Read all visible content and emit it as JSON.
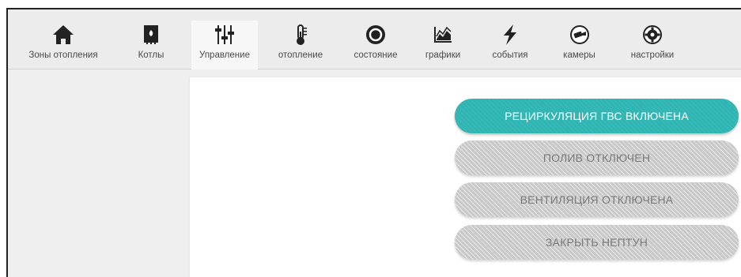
{
  "nav": {
    "tabs": [
      {
        "label": "Зоны отопления",
        "icon": "home-icon"
      },
      {
        "label": "Котлы",
        "icon": "boiler-icon"
      },
      {
        "label": "Управление",
        "icon": "sliders-icon",
        "active": true
      },
      {
        "label": "отопление",
        "icon": "thermometer-icon"
      },
      {
        "label": "состояние",
        "icon": "status-circle-icon"
      },
      {
        "label": "графики",
        "icon": "chart-icon"
      },
      {
        "label": "события",
        "icon": "lightning-icon"
      },
      {
        "label": "камеры",
        "icon": "camera-icon"
      },
      {
        "label": "настройки",
        "icon": "gear-icon"
      }
    ]
  },
  "controls": {
    "recirculation": {
      "label": "РЕЦИРКУЛЯЦИЯ ГВС ВКЛЮЧЕНА",
      "state": "on"
    },
    "watering": {
      "label": "ПОЛИВ ОТКЛЮЧЕН",
      "state": "off"
    },
    "ventilation": {
      "label": "ВЕНТИЛЯЦИЯ ОТКЛЮЧЕНА",
      "state": "off"
    },
    "neptun": {
      "label": "ЗАКРЫТЬ НЕПТУН",
      "state": "off"
    }
  },
  "colors": {
    "accent_on": "#2fb5b3",
    "button_off": "#c9c9c9",
    "icon_dark": "#222222"
  }
}
